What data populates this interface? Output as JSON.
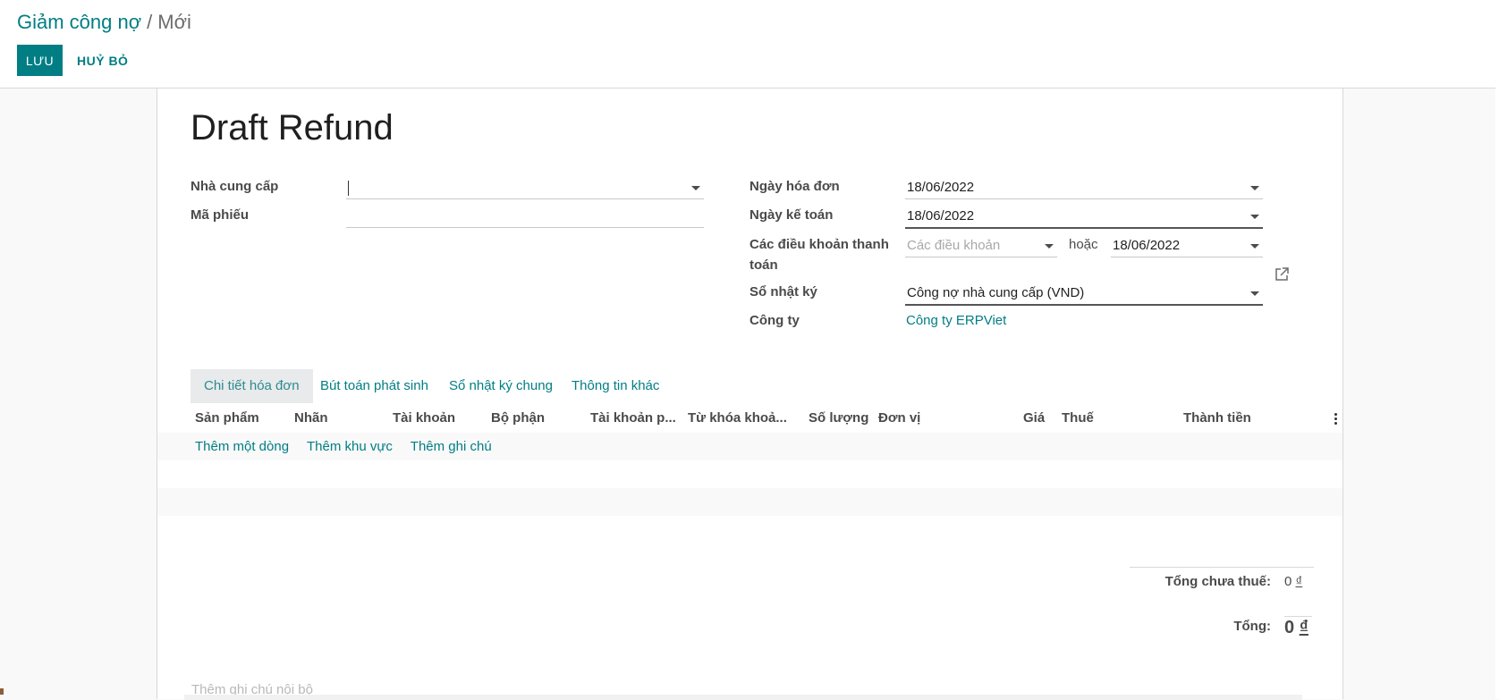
{
  "breadcrumb": {
    "parent": "Giảm công nợ",
    "separator": "/",
    "current": "Mới"
  },
  "actions": {
    "save": "LƯU",
    "discard": "HUỶ BỎ"
  },
  "form": {
    "title": "Draft Refund",
    "vendor_label": "Nhà cung cấp",
    "vendor_value": "",
    "ref_label": "Mã phiếu",
    "ref_value": "",
    "invoice_date_label": "Ngày hóa đơn",
    "invoice_date": "18/06/2022",
    "accounting_date_label": "Ngày kế toán",
    "accounting_date": "18/06/2022",
    "payment_terms_label_1": "Các điều khoản thanh",
    "payment_terms_label_2": "toán",
    "payment_terms_placeholder": "Các điều khoản",
    "or_text": "hoặc",
    "due_date": "18/06/2022",
    "journal_label": "Sổ nhật ký",
    "journal_value": "Công nợ nhà cung cấp (VND)",
    "company_label": "Công ty",
    "company_value": "Công ty ERPViet"
  },
  "tabs": [
    {
      "label": "Chi tiết hóa đơn",
      "active": true
    },
    {
      "label": "Bút toán phát sinh",
      "active": false
    },
    {
      "label": "Sổ nhật ký chung",
      "active": false
    },
    {
      "label": "Thông tin khác",
      "active": false
    }
  ],
  "table": {
    "columns": [
      "Sản phẩm",
      "Nhãn",
      "Tài khoản",
      "Bộ phận",
      "Tài khoản phân tích",
      "Từ khóa khoản mục",
      "Số lượng",
      "Đơn vị",
      "Giá",
      "Thuế",
      "Thành tiền"
    ],
    "columns_display": [
      "Sản phẩm",
      "Nhãn",
      "Tài khoản",
      "Bộ phận",
      "Tài khoản p...",
      "Từ khóa khoả...",
      "Số lượng",
      "Đơn vị",
      "Giá",
      "Thuế",
      "Thành tiền"
    ],
    "add_line": "Thêm một dòng",
    "add_section": "Thêm khu vực",
    "add_note": "Thêm ghi chú"
  },
  "totals": {
    "untaxed_label": "Tổng chưa thuế:",
    "untaxed_value": "0",
    "total_label": "Tổng:",
    "total_value": "0",
    "currency": "₫"
  },
  "internal_note_placeholder": "Thêm ghi chú nội bộ",
  "colors": {
    "primary": "#017e84",
    "text": "#4c4c4c"
  }
}
